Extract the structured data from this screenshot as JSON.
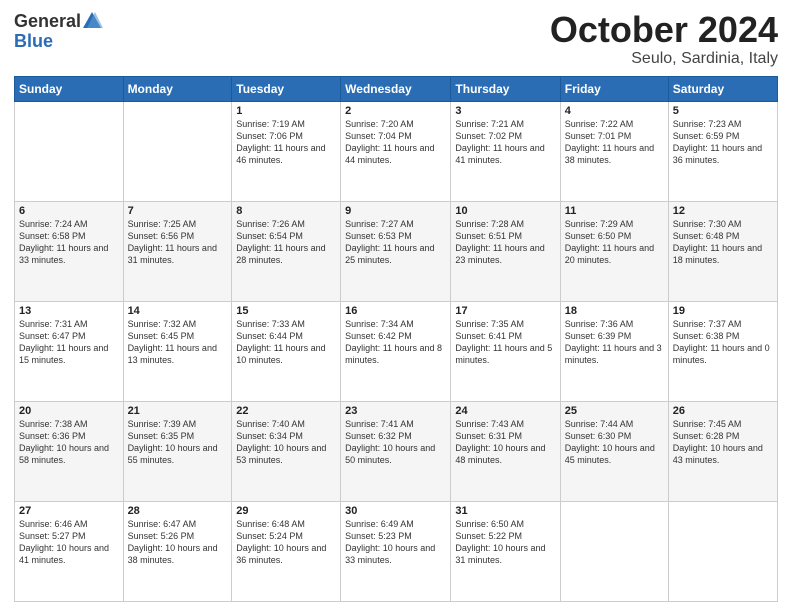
{
  "header": {
    "logo_general": "General",
    "logo_blue": "Blue",
    "month_title": "October 2024",
    "subtitle": "Seulo, Sardinia, Italy"
  },
  "days_of_week": [
    "Sunday",
    "Monday",
    "Tuesday",
    "Wednesday",
    "Thursday",
    "Friday",
    "Saturday"
  ],
  "weeks": [
    [
      {
        "day": "",
        "sunrise": "",
        "sunset": "",
        "daylight": ""
      },
      {
        "day": "",
        "sunrise": "",
        "sunset": "",
        "daylight": ""
      },
      {
        "day": "1",
        "sunrise": "Sunrise: 7:19 AM",
        "sunset": "Sunset: 7:06 PM",
        "daylight": "Daylight: 11 hours and 46 minutes."
      },
      {
        "day": "2",
        "sunrise": "Sunrise: 7:20 AM",
        "sunset": "Sunset: 7:04 PM",
        "daylight": "Daylight: 11 hours and 44 minutes."
      },
      {
        "day": "3",
        "sunrise": "Sunrise: 7:21 AM",
        "sunset": "Sunset: 7:02 PM",
        "daylight": "Daylight: 11 hours and 41 minutes."
      },
      {
        "day": "4",
        "sunrise": "Sunrise: 7:22 AM",
        "sunset": "Sunset: 7:01 PM",
        "daylight": "Daylight: 11 hours and 38 minutes."
      },
      {
        "day": "5",
        "sunrise": "Sunrise: 7:23 AM",
        "sunset": "Sunset: 6:59 PM",
        "daylight": "Daylight: 11 hours and 36 minutes."
      }
    ],
    [
      {
        "day": "6",
        "sunrise": "Sunrise: 7:24 AM",
        "sunset": "Sunset: 6:58 PM",
        "daylight": "Daylight: 11 hours and 33 minutes."
      },
      {
        "day": "7",
        "sunrise": "Sunrise: 7:25 AM",
        "sunset": "Sunset: 6:56 PM",
        "daylight": "Daylight: 11 hours and 31 minutes."
      },
      {
        "day": "8",
        "sunrise": "Sunrise: 7:26 AM",
        "sunset": "Sunset: 6:54 PM",
        "daylight": "Daylight: 11 hours and 28 minutes."
      },
      {
        "day": "9",
        "sunrise": "Sunrise: 7:27 AM",
        "sunset": "Sunset: 6:53 PM",
        "daylight": "Daylight: 11 hours and 25 minutes."
      },
      {
        "day": "10",
        "sunrise": "Sunrise: 7:28 AM",
        "sunset": "Sunset: 6:51 PM",
        "daylight": "Daylight: 11 hours and 23 minutes."
      },
      {
        "day": "11",
        "sunrise": "Sunrise: 7:29 AM",
        "sunset": "Sunset: 6:50 PM",
        "daylight": "Daylight: 11 hours and 20 minutes."
      },
      {
        "day": "12",
        "sunrise": "Sunrise: 7:30 AM",
        "sunset": "Sunset: 6:48 PM",
        "daylight": "Daylight: 11 hours and 18 minutes."
      }
    ],
    [
      {
        "day": "13",
        "sunrise": "Sunrise: 7:31 AM",
        "sunset": "Sunset: 6:47 PM",
        "daylight": "Daylight: 11 hours and 15 minutes."
      },
      {
        "day": "14",
        "sunrise": "Sunrise: 7:32 AM",
        "sunset": "Sunset: 6:45 PM",
        "daylight": "Daylight: 11 hours and 13 minutes."
      },
      {
        "day": "15",
        "sunrise": "Sunrise: 7:33 AM",
        "sunset": "Sunset: 6:44 PM",
        "daylight": "Daylight: 11 hours and 10 minutes."
      },
      {
        "day": "16",
        "sunrise": "Sunrise: 7:34 AM",
        "sunset": "Sunset: 6:42 PM",
        "daylight": "Daylight: 11 hours and 8 minutes."
      },
      {
        "day": "17",
        "sunrise": "Sunrise: 7:35 AM",
        "sunset": "Sunset: 6:41 PM",
        "daylight": "Daylight: 11 hours and 5 minutes."
      },
      {
        "day": "18",
        "sunrise": "Sunrise: 7:36 AM",
        "sunset": "Sunset: 6:39 PM",
        "daylight": "Daylight: 11 hours and 3 minutes."
      },
      {
        "day": "19",
        "sunrise": "Sunrise: 7:37 AM",
        "sunset": "Sunset: 6:38 PM",
        "daylight": "Daylight: 11 hours and 0 minutes."
      }
    ],
    [
      {
        "day": "20",
        "sunrise": "Sunrise: 7:38 AM",
        "sunset": "Sunset: 6:36 PM",
        "daylight": "Daylight: 10 hours and 58 minutes."
      },
      {
        "day": "21",
        "sunrise": "Sunrise: 7:39 AM",
        "sunset": "Sunset: 6:35 PM",
        "daylight": "Daylight: 10 hours and 55 minutes."
      },
      {
        "day": "22",
        "sunrise": "Sunrise: 7:40 AM",
        "sunset": "Sunset: 6:34 PM",
        "daylight": "Daylight: 10 hours and 53 minutes."
      },
      {
        "day": "23",
        "sunrise": "Sunrise: 7:41 AM",
        "sunset": "Sunset: 6:32 PM",
        "daylight": "Daylight: 10 hours and 50 minutes."
      },
      {
        "day": "24",
        "sunrise": "Sunrise: 7:43 AM",
        "sunset": "Sunset: 6:31 PM",
        "daylight": "Daylight: 10 hours and 48 minutes."
      },
      {
        "day": "25",
        "sunrise": "Sunrise: 7:44 AM",
        "sunset": "Sunset: 6:30 PM",
        "daylight": "Daylight: 10 hours and 45 minutes."
      },
      {
        "day": "26",
        "sunrise": "Sunrise: 7:45 AM",
        "sunset": "Sunset: 6:28 PM",
        "daylight": "Daylight: 10 hours and 43 minutes."
      }
    ],
    [
      {
        "day": "27",
        "sunrise": "Sunrise: 6:46 AM",
        "sunset": "Sunset: 5:27 PM",
        "daylight": "Daylight: 10 hours and 41 minutes."
      },
      {
        "day": "28",
        "sunrise": "Sunrise: 6:47 AM",
        "sunset": "Sunset: 5:26 PM",
        "daylight": "Daylight: 10 hours and 38 minutes."
      },
      {
        "day": "29",
        "sunrise": "Sunrise: 6:48 AM",
        "sunset": "Sunset: 5:24 PM",
        "daylight": "Daylight: 10 hours and 36 minutes."
      },
      {
        "day": "30",
        "sunrise": "Sunrise: 6:49 AM",
        "sunset": "Sunset: 5:23 PM",
        "daylight": "Daylight: 10 hours and 33 minutes."
      },
      {
        "day": "31",
        "sunrise": "Sunrise: 6:50 AM",
        "sunset": "Sunset: 5:22 PM",
        "daylight": "Daylight: 10 hours and 31 minutes."
      },
      {
        "day": "",
        "sunrise": "",
        "sunset": "",
        "daylight": ""
      },
      {
        "day": "",
        "sunrise": "",
        "sunset": "",
        "daylight": ""
      }
    ]
  ]
}
